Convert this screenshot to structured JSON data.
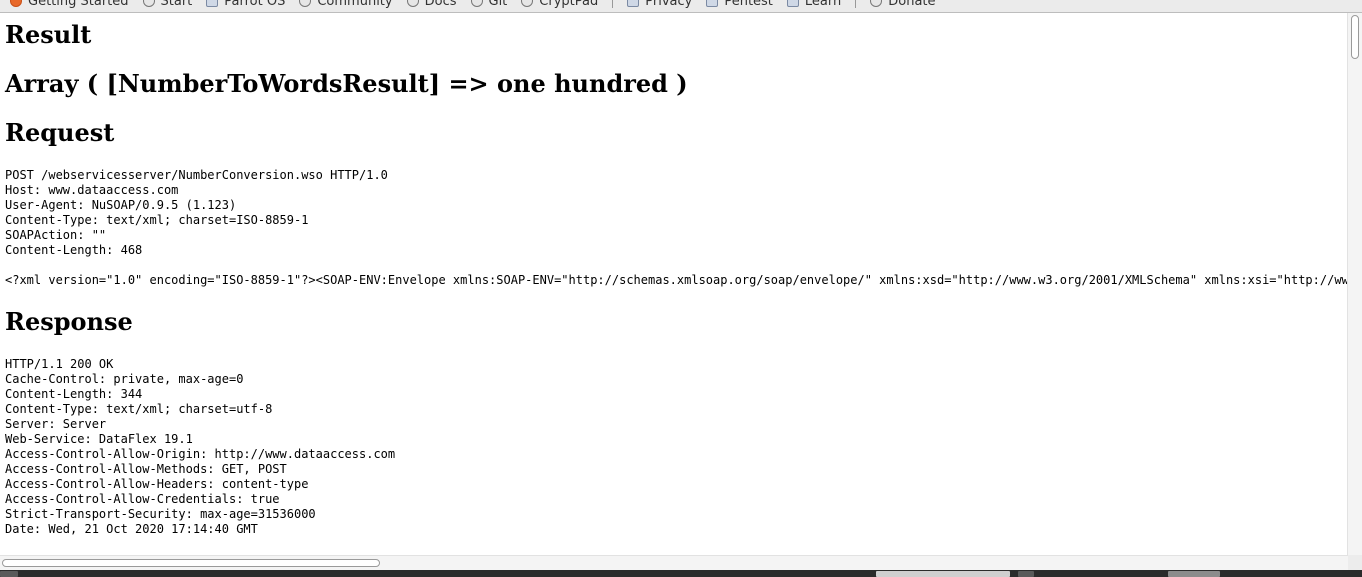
{
  "bookmarks": [
    {
      "label": "Getting Started",
      "icon": "firefox-icon"
    },
    {
      "label": "Start",
      "icon": "globe-icon"
    },
    {
      "label": "Parrot OS",
      "icon": "parrot-icon"
    },
    {
      "label": "Community",
      "icon": "globe-icon"
    },
    {
      "label": "Docs",
      "icon": "globe-icon"
    },
    {
      "label": "Git",
      "icon": "globe-icon"
    },
    {
      "label": "CryptPad",
      "icon": "globe-icon"
    },
    {
      "label": "Privacy",
      "icon": "folder-icon"
    },
    {
      "label": "Pentest",
      "icon": "folder-icon"
    },
    {
      "label": "Learn",
      "icon": "folder-icon"
    },
    {
      "label": "Donate",
      "icon": "globe-icon"
    }
  ],
  "result": {
    "heading": "Result",
    "value": "Array ( [NumberToWordsResult] => one hundred )"
  },
  "request": {
    "heading": "Request",
    "headers": "POST /webservicesserver/NumberConversion.wso HTTP/1.0\nHost: www.dataaccess.com\nUser-Agent: NuSOAP/0.9.5 (1.123)\nContent-Type: text/xml; charset=ISO-8859-1\nSOAPAction: \"\"\nContent-Length: 468",
    "body": "<?xml version=\"1.0\" encoding=\"ISO-8859-1\"?><SOAP-ENV:Envelope xmlns:SOAP-ENV=\"http://schemas.xmlsoap.org/soap/envelope/\" xmlns:xsd=\"http://www.w3.org/2001/XMLSchema\" xmlns:xsi=\"http://www"
  },
  "response": {
    "heading": "Response",
    "headers": "HTTP/1.1 200 OK\nCache-Control: private, max-age=0\nContent-Length: 344\nContent-Type: text/xml; charset=utf-8\nServer: Server\nWeb-Service: DataFlex 19.1\nAccess-Control-Allow-Origin: http://www.dataaccess.com\nAccess-Control-Allow-Methods: GET, POST\nAccess-Control-Allow-Headers: content-type\nAccess-Control-Allow-Credentials: true\nStrict-Transport-Security: max-age=31536000\nDate: Wed, 21 Oct 2020 17:14:40 GMT"
  }
}
